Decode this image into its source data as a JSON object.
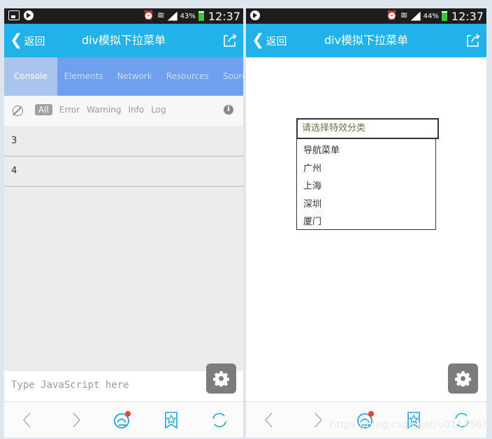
{
  "status_left": {
    "battery_percent": "43%",
    "time": "12:37"
  },
  "status_right": {
    "battery_percent": "44%",
    "time": "12:37"
  },
  "header": {
    "back_label": "返回",
    "title": "div模拟下拉菜单"
  },
  "devtools": {
    "tabs": [
      "Console",
      "Elements",
      "Network",
      "Resources",
      "Sourc"
    ],
    "active_tab": "Console",
    "filters": [
      "All",
      "Error",
      "Warning",
      "Info",
      "Log"
    ],
    "active_filter": "All",
    "logs": [
      "3",
      "4"
    ],
    "input_placeholder": "Type JavaScript here"
  },
  "dropdown": {
    "placeholder": "请选择特效分类",
    "options": [
      "导航菜单",
      "广州",
      "上海",
      "深圳",
      "厦门"
    ]
  },
  "icons": {
    "back": "chevron-left-icon",
    "forward": "chevron-right-icon",
    "home": "home-icon",
    "bookmark": "bookmark-star-icon",
    "refresh": "refresh-icon",
    "settings": "gear-icon",
    "share": "share-icon"
  },
  "colors": {
    "header_bg": "#20b2e8",
    "tabs_bg": "#6fa0ee",
    "active_tab_bg": "#a9c4ee",
    "icon_blue": "#1ea4dc",
    "notification": "#e8452c"
  },
  "watermark": "https://blog.csdn.net/u011456337"
}
